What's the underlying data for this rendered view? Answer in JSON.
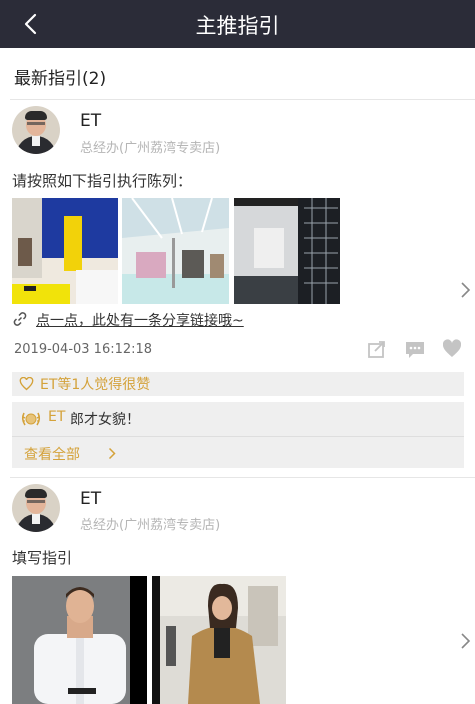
{
  "header": {
    "title": "主推指引"
  },
  "section": {
    "title": "最新指引(2)"
  },
  "posts": [
    {
      "author": "ET",
      "role": "总经办(广州荔湾专卖店)",
      "text": "请按照如下指引执行陈列：",
      "link_text": "点一点，此处有一条分享链接哦~",
      "timestamp": "2019-04-03 16:12:18",
      "like_text": "ET等1人觉得很赞",
      "comment": {
        "author": "ET",
        "text": "郎才女貌！"
      },
      "view_all": "查看全部"
    },
    {
      "author": "ET",
      "role": "总经办(广州荔湾专卖店)",
      "text": "填写指引"
    }
  ],
  "icons": {
    "back": "back-arrow-icon",
    "link": "link-icon",
    "share": "share-icon",
    "comment": "comment-icon",
    "like": "heart-icon",
    "chevron": "chevron-right-icon",
    "badge": "laurel-badge-icon"
  },
  "colors": {
    "header_bg": "#2b2c38",
    "accent": "#d4a23a",
    "divider": "#e6e6e6"
  }
}
